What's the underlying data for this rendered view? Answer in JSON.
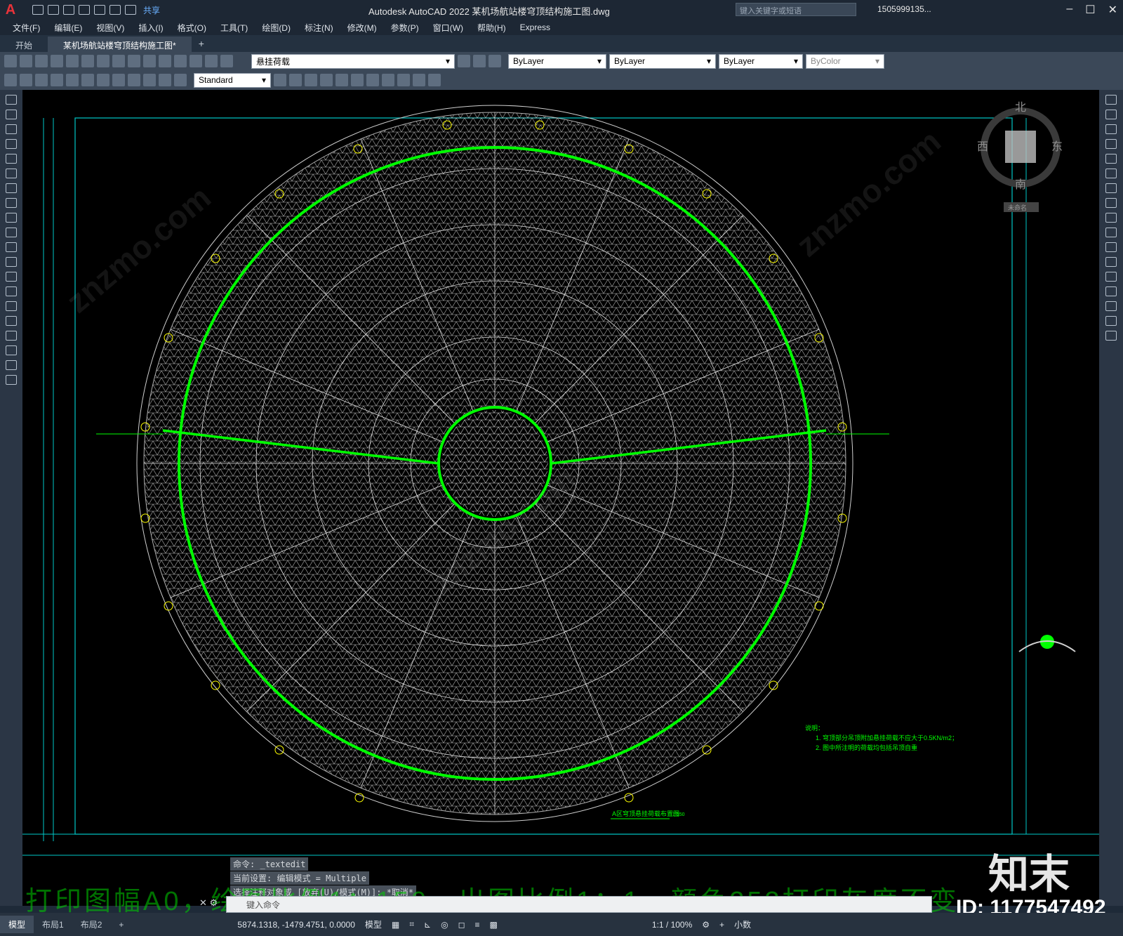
{
  "app": {
    "logo": "A",
    "title": "Autodesk AutoCAD 2022    某机场航站楼穹顶结构施工图.dwg",
    "share_label": "共享",
    "search_placeholder": "键入关键字或短语",
    "user": "1505999135...",
    "colors": {
      "accent": "#00ff00",
      "background": "#000000",
      "frame": "#00c8c8",
      "mesh": "#d8d8d8"
    }
  },
  "menu": [
    "文件(F)",
    "编辑(E)",
    "视图(V)",
    "插入(I)",
    "格式(O)",
    "工具(T)",
    "绘图(D)",
    "标注(N)",
    "修改(M)",
    "参数(P)",
    "窗口(W)",
    "帮助(H)",
    "Express"
  ],
  "tabs": [
    {
      "label": "开始"
    },
    {
      "label": "某机场航站楼穹顶结构施工图*"
    }
  ],
  "toolbar": {
    "layer": "悬挂荷载",
    "color": "ByLayer",
    "linetype": "ByLayer",
    "lineweight": "ByLayer",
    "plotstyle": "ByColor",
    "textstyle": "Standard"
  },
  "viewcube": {
    "north": "北",
    "south": "南",
    "east": "东",
    "west": "西",
    "ucs": "未命名"
  },
  "drawing": {
    "notes_title": "说明：",
    "note1": "1. 穹顶部分吊顶附加悬挂荷载不应大于0.5KN/m2；",
    "note2": "2. 图中所注明的荷载均包括吊顶自重",
    "caption": "A区穹顶悬挂荷载布置图",
    "scale": "1:150"
  },
  "command": {
    "history": [
      "命令: _textedit",
      "当前设置: 编辑模式 = Multiple",
      "选择注释对象或 [放弃(U)/模式(M)]: *取消*"
    ],
    "overlay": "打印图幅A0，绘图比例1：150，出图比例1：1，颜色253打印灰度不变",
    "placeholder": "键入命令"
  },
  "status": {
    "tabs": [
      "模型",
      "布局1",
      "布局2"
    ],
    "coords": "5874.1318, -1479.4751, 0.0000",
    "mode": "模型",
    "scale": "1:1 / 100%",
    "units": "小数"
  },
  "brand": {
    "name": "知末",
    "id": "ID: 1177547492"
  }
}
